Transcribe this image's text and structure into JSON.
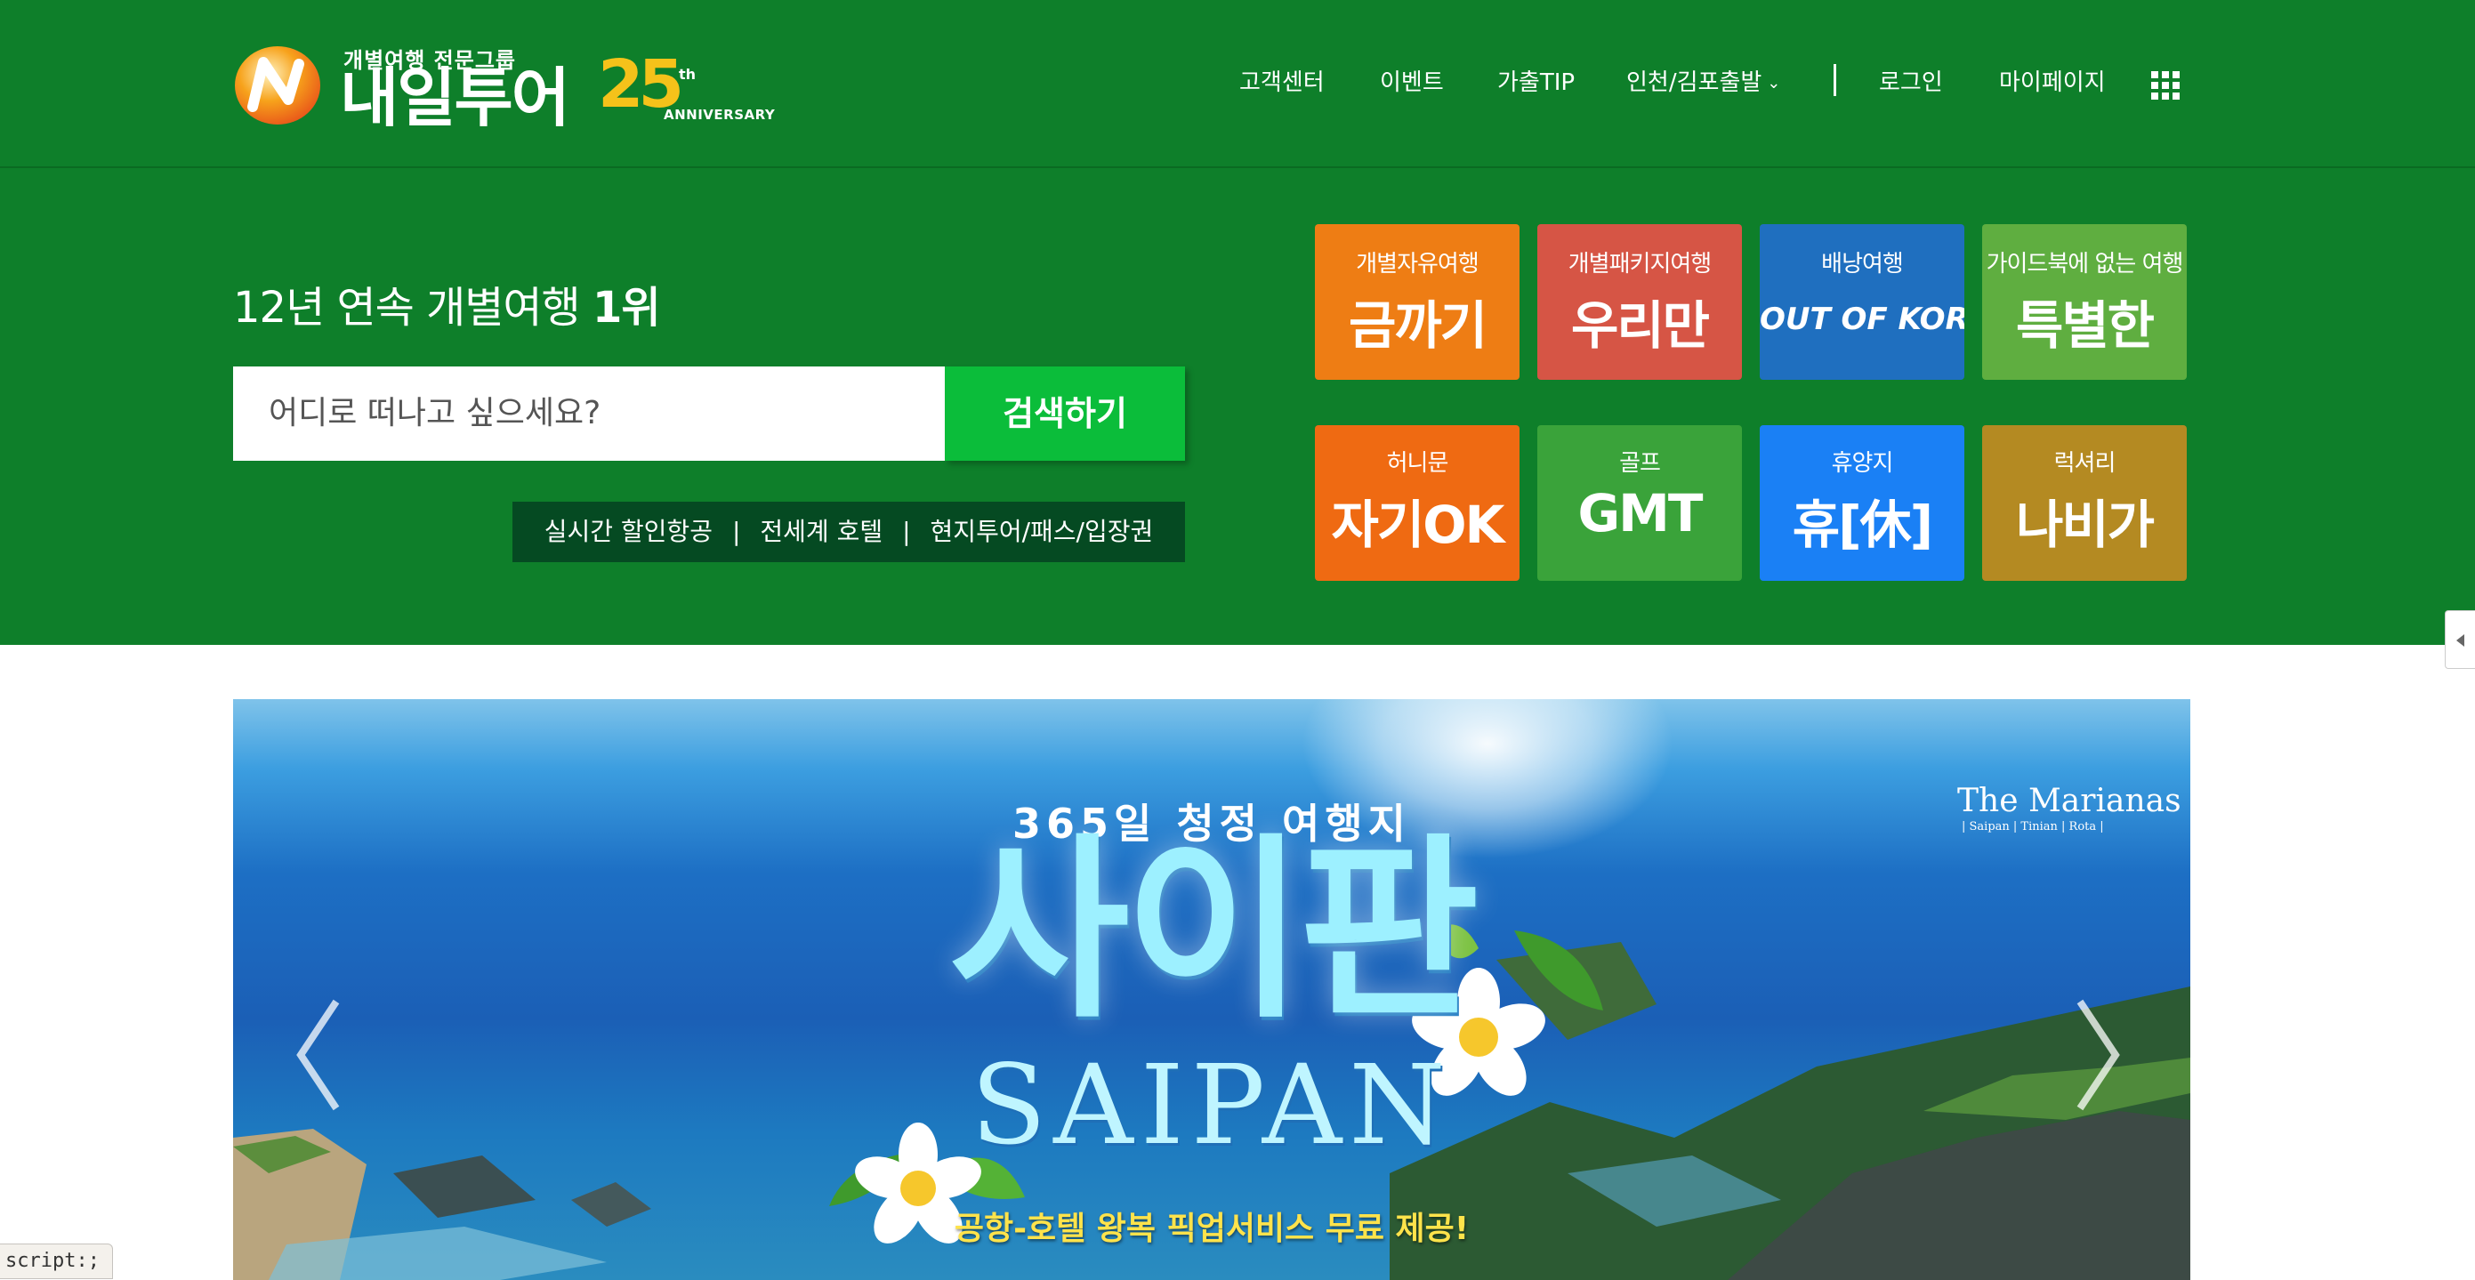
{
  "header": {
    "logo": {
      "tagline": "개별여행 전문그룹",
      "name": "내일투어",
      "anniversary_number": "25",
      "anniversary_suffix": "th",
      "anniversary_label": "ANNIVERSARY"
    },
    "nav": [
      {
        "label": "고객센터"
      },
      {
        "label": "이벤트"
      },
      {
        "label": "가출TIP"
      },
      {
        "label": "인천/김포출발"
      },
      {
        "label": "로그인"
      },
      {
        "label": "마이페이지"
      }
    ],
    "menu_icon": "grid-menu-icon"
  },
  "hero": {
    "headline_prefix": "12년 연속 개별여행 ",
    "headline_emphasis": "1위",
    "search": {
      "placeholder": "어디로 떠나고 싶으세요?",
      "button": "검색하기"
    },
    "quick_links": [
      "실시간 할인항공",
      "전세계 호텔",
      "현지투어/패스/입장권"
    ],
    "quick_links_separator": "|",
    "tiles": [
      {
        "sub": "개별자유여행",
        "title": "금까기",
        "color": "#ee7d14"
      },
      {
        "sub": "개별패키지여행",
        "title": "우리만",
        "color": "#d65545"
      },
      {
        "sub": "배낭여행",
        "title": "OUT OF KOREA",
        "color": "#1f6fbf"
      },
      {
        "sub": "가이드북에 없는 여행",
        "title": "특별한",
        "color": "#5fae40"
      },
      {
        "sub": "허니문",
        "title": "자기OK",
        "color": "#ef6a12"
      },
      {
        "sub": "골프",
        "title": "GMT",
        "color": "#3aa33a"
      },
      {
        "sub": "휴양지",
        "title": "휴[休]",
        "color": "#1a80f5"
      },
      {
        "sub": "럭셔리",
        "title": "나비가",
        "color": "#b48a22"
      }
    ]
  },
  "banner": {
    "kicker": "365일 청정 여행지",
    "title": "사이판",
    "title_en": "SAIPAN",
    "caption": "공항-호텔 왕복 픽업서비스 무료 제공!",
    "brand": "The Marianas",
    "brand_sub": "| Saipan | Tinian | Rota |"
  },
  "status_bar": {
    "text": "script:;"
  },
  "colors": {
    "brand_green": "#0e7f2a",
    "search_button": "#0bbd3a",
    "quick_links_bg": "#054a22",
    "banner_caption": "#ffe34b"
  }
}
